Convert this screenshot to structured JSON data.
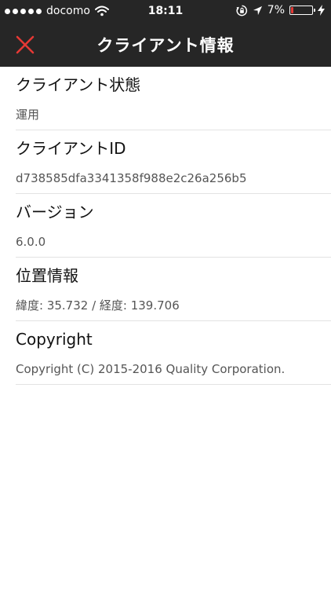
{
  "status_bar": {
    "carrier": "docomo",
    "time": "18:11",
    "battery_text": "7%",
    "battery_level": 0.07,
    "colors": {
      "battery_low": "#e53935"
    },
    "icons": [
      "signal-dots-icon",
      "wifi-icon",
      "rotation-lock-icon",
      "location-arrow-icon",
      "battery-icon",
      "charging-bolt-icon"
    ]
  },
  "nav": {
    "title": "クライアント情報",
    "close_icon": "close-x-icon",
    "close_color": "#e53935",
    "background": "#262626"
  },
  "items": [
    {
      "label": "クライアント状態",
      "value": "運用"
    },
    {
      "label": "クライアントID",
      "value": "d738585dfa3341358f988e2c26a256b5"
    },
    {
      "label": "バージョン",
      "value": "6.0.0"
    },
    {
      "label": "位置情報",
      "value": "緯度: 35.732 / 経度: 139.706"
    },
    {
      "label": "Copyright",
      "value": "Copyright (C) 2015-2016 Quality Corporation."
    }
  ]
}
